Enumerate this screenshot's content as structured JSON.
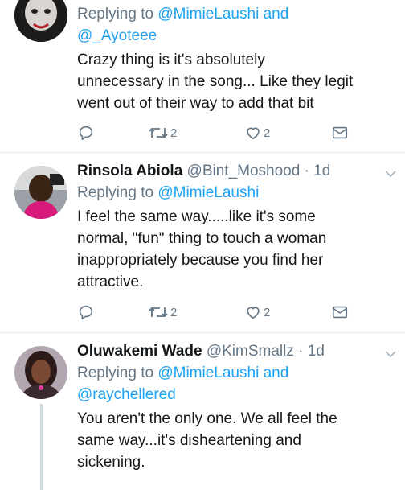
{
  "tweets": [
    {
      "replying_prefix": "Replying to",
      "mention1": "@MimieLaushi",
      "and_word": " and",
      "mention2": "@_Ayoteee",
      "text_lines": [
        "Crazy thing is it's absolutely",
        "unnecessary in the song... Like they legit",
        "went out of their way to add that bit"
      ],
      "retweets": "2",
      "likes": "2"
    },
    {
      "name": "Rinsola Abiola",
      "handle": "@Bint_Moshood",
      "time": "· 1d",
      "replying_prefix": "Replying to",
      "mention1": "@MimieLaushi",
      "text_lines": [
        "I feel the same way.....like it's some",
        "normal, \"fun\" thing to touch a woman",
        "inappropriately because you find her",
        "attractive."
      ],
      "retweets": "2",
      "likes": "2"
    },
    {
      "name": "Oluwakemi Wade",
      "handle": "@KimSmallz",
      "time": "· 1d",
      "replying_prefix": "Replying to",
      "mention1": "@MimieLaushi",
      "and_word": " and",
      "mention2": "@raychellered",
      "text_lines": [
        "You aren't the only one. We all feel the",
        "same way...it's disheartening and",
        "sickening."
      ]
    }
  ],
  "icons": {
    "reply": "reply-icon",
    "retweet": "retweet-icon",
    "like": "heart-icon",
    "message": "direct-message-icon",
    "more": "chevron-down-icon"
  },
  "colors": {
    "mention": "#1da1f2",
    "secondary_text": "#657786",
    "divider": "#e6ecf0"
  }
}
